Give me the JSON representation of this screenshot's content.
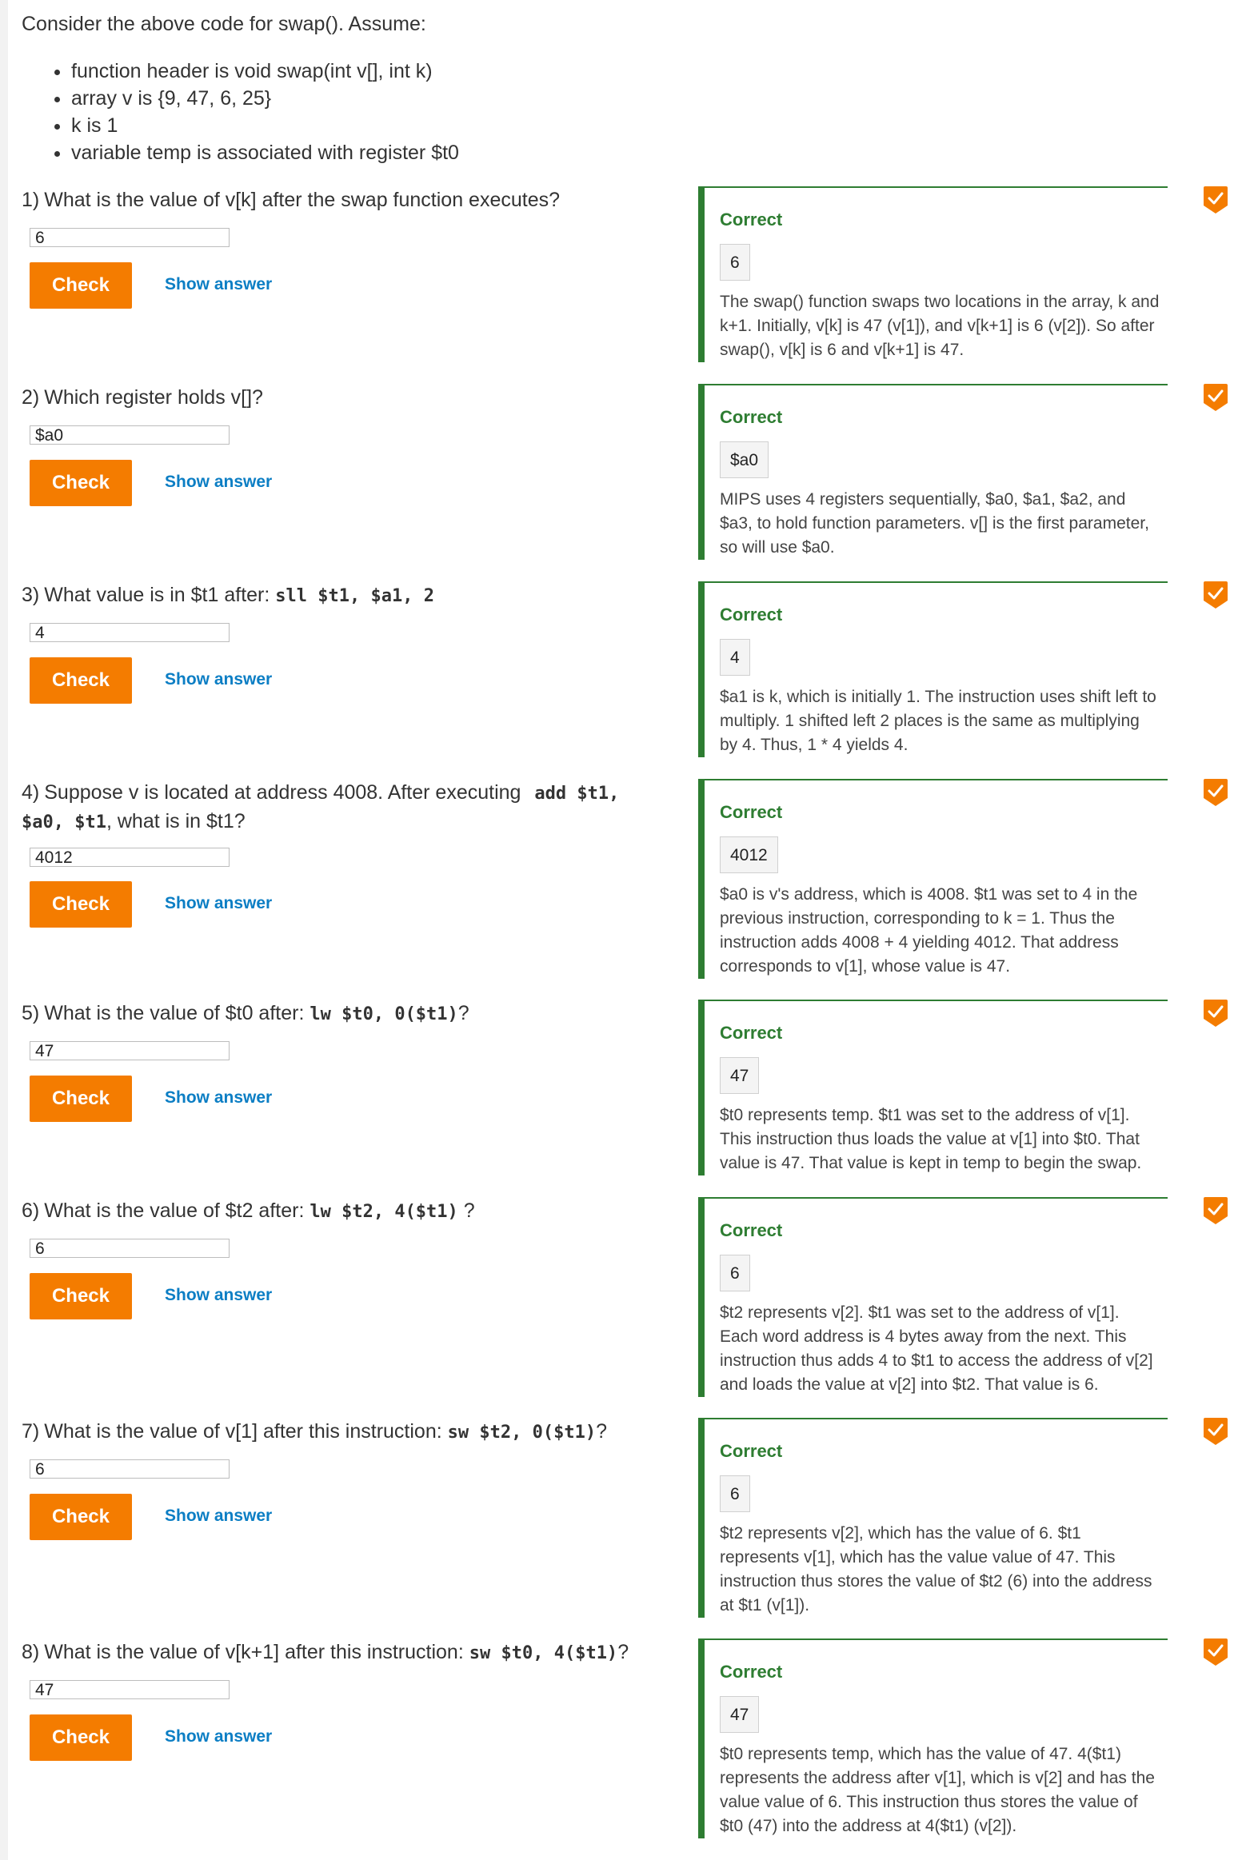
{
  "intro": {
    "text": "Consider the above code for swap(). Assume:",
    "assumptions": [
      "function header is void swap(int v[], int k)",
      "array v is {9, 47, 6, 25}",
      "k is 1",
      "variable temp is associated with register $t0"
    ]
  },
  "controls": {
    "check_label": "Check",
    "show_answer_label": "Show answer",
    "correct_label": "Correct"
  },
  "colors": {
    "accent": "#f47c00",
    "correct": "#2e7d32",
    "link": "#0c7ec4"
  },
  "questions": [
    {
      "num": "1)",
      "prompt_pre": "What is the value of v[k] after the swap function executes?",
      "code": "",
      "prompt_post": "",
      "answer": "6",
      "feedback_value": "6",
      "explanation": "The swap() function swaps two locations in the array, k and k+1. Initially, v[k] is 47 (v[1]), and v[k+1] is 6 (v[2]). So after swap(), v[k] is 6 and v[k+1] is 47."
    },
    {
      "num": "2)",
      "prompt_pre": "Which register holds v[]?",
      "code": "",
      "prompt_post": "",
      "answer": "$a0",
      "feedback_value": "$a0",
      "explanation": "MIPS uses 4 registers sequentially, $a0, $a1, $a2, and $a3, to hold function parameters. v[] is the first parameter, so will use $a0."
    },
    {
      "num": "3)",
      "prompt_pre": "What value is in $t1 after:",
      "code": "sll $t1, $a1, 2",
      "prompt_post": "",
      "answer": "4",
      "feedback_value": "4",
      "explanation": "$a1 is k, which is initially 1. The instruction uses shift left to multiply. 1 shifted left 2 places is the same as multiplying by 4. Thus, 1 * 4 yields 4."
    },
    {
      "num": "4)",
      "prompt_pre": "Suppose v is located at address 4008. After executing",
      "code": "add $t1, $a0, $t1",
      "prompt_post": ", what is in $t1?",
      "answer": "4012",
      "feedback_value": "4012",
      "explanation": "$a0 is v's address, which is 4008. $t1 was set to 4 in the previous instruction, corresponding to k = 1. Thus the instruction adds 4008 + 4 yielding 4012. That address corresponds to v[1], whose value is 47."
    },
    {
      "num": "5)",
      "prompt_pre": "What is the value of $t0 after:",
      "code": "lw $t0, 0($t1)",
      "prompt_post": "?",
      "answer": "47",
      "feedback_value": "47",
      "explanation": "$t0 represents temp. $t1 was set to the address of v[1]. This instruction thus loads the value at v[1] into $t0. That value is 47. That value is kept in temp to begin the swap."
    },
    {
      "num": "6)",
      "prompt_pre": "What is the value of $t2 after:",
      "code": "lw $t2, 4($t1)",
      "prompt_post": " ?",
      "answer": "6",
      "feedback_value": "6",
      "explanation": "$t2 represents v[2]. $t1 was set to the address of v[1]. Each word address is 4 bytes away from the next. This instruction thus adds 4 to $t1 to access the address of v[2] and loads the value at v[2] into $t2. That value is 6."
    },
    {
      "num": "7)",
      "prompt_pre": "What is the value of v[1] after this instruction:",
      "code": "sw $t2, 0($t1)",
      "prompt_post": "?",
      "answer": "6",
      "feedback_value": "6",
      "explanation": "$t2 represents v[2], which has the value of 6. $t1 represents v[1], which has the value value of 47. This instruction thus stores the value of $t2 (6) into the address at $t1 (v[1])."
    },
    {
      "num": "8)",
      "prompt_pre": "What is the value of v[k+1] after this instruction:",
      "code": "sw $t0, 4($t1)",
      "prompt_post": "?",
      "answer": "47",
      "feedback_value": "47",
      "explanation": "$t0 represents temp, which has the value of 47. 4($t1) represents the address after v[1], which is v[2] and has the value value of 6. This instruction thus stores the value of $t0 (47) into the address at 4($t1) (v[2])."
    }
  ]
}
